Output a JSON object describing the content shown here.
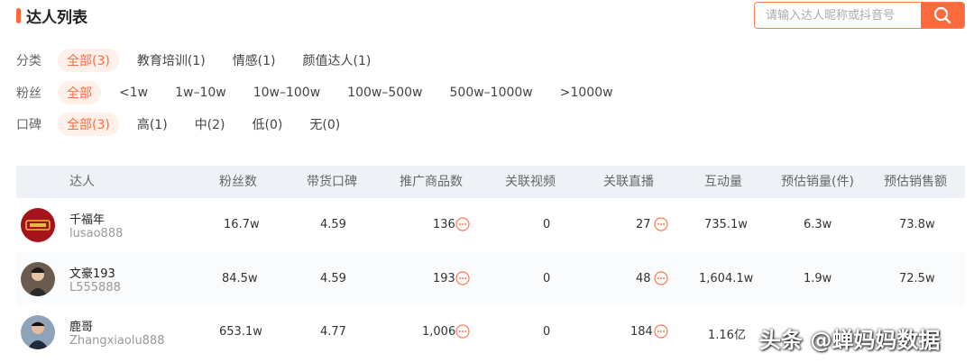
{
  "header": {
    "title": "达人列表"
  },
  "search": {
    "placeholder": "请输入达人昵称或抖音号"
  },
  "filters": {
    "category": {
      "label": "分类",
      "options": [
        "全部(3)",
        "教育培训(1)",
        "情感(1)",
        "颜值达人(1)"
      ]
    },
    "fans": {
      "label": "粉丝",
      "options": [
        "全部",
        "<1w",
        "1w–10w",
        "10w–100w",
        "100w–500w",
        "500w–1000w",
        ">1000w"
      ]
    },
    "reputation": {
      "label": "口碑",
      "options": [
        "全部(3)",
        "高(1)",
        "中(2)",
        "低(0)",
        "无(0)"
      ]
    }
  },
  "table": {
    "columns": [
      "达人",
      "粉丝数",
      "带货口碑",
      "推广商品数",
      "关联视频",
      "关联直播",
      "互动量",
      "预估销量(件)",
      "预估销售额"
    ],
    "rows": [
      {
        "name": "千福年",
        "handle": "lusao888",
        "fans": "16.7w",
        "rating": "4.59",
        "products": "136",
        "videos": "0",
        "lives": "27",
        "interactions": "735.1w",
        "sales_qty": "6.3w",
        "sales_amt": "73.8w"
      },
      {
        "name": "文豪193",
        "handle": "L555888",
        "fans": "84.5w",
        "rating": "4.59",
        "products": "193",
        "videos": "0",
        "lives": "48",
        "interactions": "1,604.1w",
        "sales_qty": "1.9w",
        "sales_amt": "72.5w"
      },
      {
        "name": "鹿哥",
        "handle": "Zhangxiaolu888",
        "fans": "653.1w",
        "rating": "4.77",
        "products": "1,006",
        "videos": "0",
        "lives": "184",
        "interactions": "1.16亿",
        "sales_qty": "",
        "sales_amt": ""
      }
    ]
  },
  "watermark": "头条 @蝉妈妈数据",
  "colors": {
    "accent": "#ff6a3d",
    "header_bg": "#eef2f7"
  }
}
